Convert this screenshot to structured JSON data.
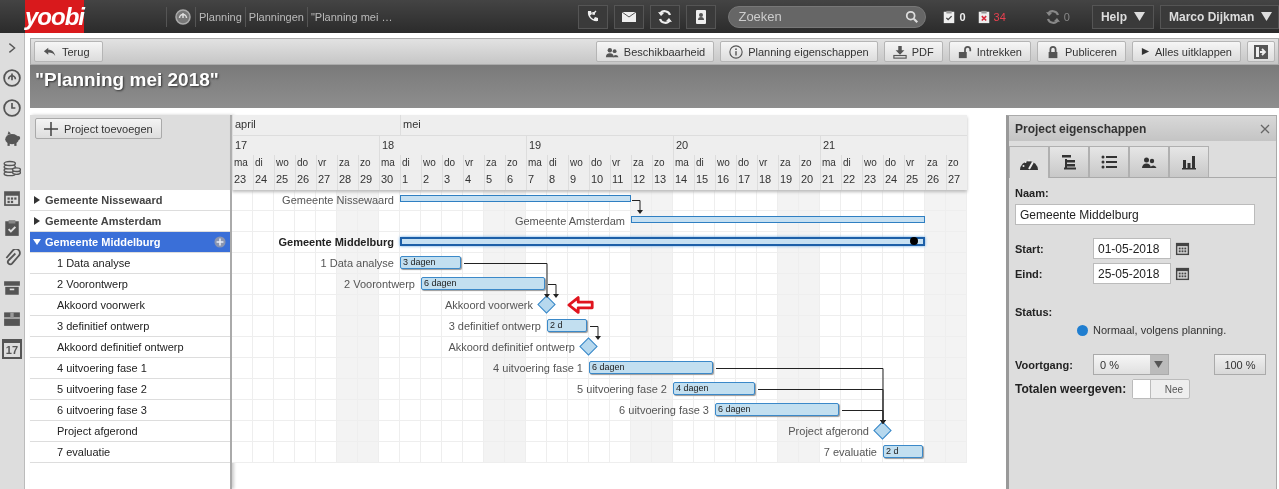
{
  "topbar": {
    "logo": "yoobi",
    "breadcrumbs": [
      "Planning",
      "Planningen",
      "\"Planning mei …"
    ],
    "search": {
      "placeholder": "Zoeken"
    },
    "approved_count": "0",
    "rejected_count": "34",
    "sync_count": "0",
    "help": "Help",
    "user": "Marco Dijkman"
  },
  "sidebar": {
    "calendar_day": "17"
  },
  "toolbar": {
    "back": "Terug",
    "buttons": [
      {
        "label": "Beschikbaarheid",
        "kind": "people"
      },
      {
        "label": "Planning eigenschappen",
        "kind": "info"
      },
      {
        "label": "PDF",
        "kind": "download"
      },
      {
        "label": "Intrekken",
        "kind": "unlock"
      },
      {
        "label": "Publiceren",
        "kind": "lock"
      },
      {
        "label": "Alles uitklappen",
        "kind": "play"
      }
    ]
  },
  "title": "\"Planning mei 2018\"",
  "projects": {
    "add_button": "Project toevoegen",
    "items": [
      {
        "name": "Gemeente Nissewaard",
        "expanded": false,
        "selected": false
      },
      {
        "name": "Gemeente Amsterdam",
        "expanded": false,
        "selected": false
      },
      {
        "name": "Gemeente Middelburg",
        "expanded": true,
        "selected": true,
        "children": [
          {
            "name": "1 Data analyse"
          },
          {
            "name": "2 Voorontwerp"
          },
          {
            "name": "Akkoord voorwerk"
          },
          {
            "name": "3 definitief ontwerp"
          },
          {
            "name": "Akkoord definitief ontwerp"
          },
          {
            "name": "4 uitvoering fase 1"
          },
          {
            "name": "5 uitvoering fase 2"
          },
          {
            "name": "6 uitvoering fase 3"
          },
          {
            "name": "Project afgerond"
          },
          {
            "name": "7 evaluatie"
          }
        ]
      }
    ]
  },
  "timeline": {
    "months": [
      "april",
      "mei"
    ],
    "weeks": [
      {
        "number": "17",
        "days": [
          {
            "dow": "ma",
            "date": "23",
            "weekend": false
          },
          {
            "dow": "di",
            "date": "24",
            "weekend": false
          },
          {
            "dow": "wo",
            "date": "25",
            "weekend": false
          },
          {
            "dow": "do",
            "date": "26",
            "weekend": false
          },
          {
            "dow": "vr",
            "date": "27",
            "weekend": false
          },
          {
            "dow": "za",
            "date": "28",
            "weekend": true
          },
          {
            "dow": "zo",
            "date": "29",
            "weekend": true
          }
        ]
      },
      {
        "number": "18",
        "days": [
          {
            "dow": "ma",
            "date": "30",
            "weekend": false
          },
          {
            "dow": "di",
            "date": "1",
            "weekend": false
          },
          {
            "dow": "wo",
            "date": "2",
            "weekend": false
          },
          {
            "dow": "do",
            "date": "3",
            "weekend": false
          },
          {
            "dow": "vr",
            "date": "4",
            "weekend": false
          },
          {
            "dow": "za",
            "date": "5",
            "weekend": true
          },
          {
            "dow": "zo",
            "date": "6",
            "weekend": true
          }
        ]
      },
      {
        "number": "19",
        "days": [
          {
            "dow": "ma",
            "date": "7",
            "weekend": false
          },
          {
            "dow": "di",
            "date": "8",
            "weekend": false
          },
          {
            "dow": "wo",
            "date": "9",
            "weekend": false
          },
          {
            "dow": "do",
            "date": "10",
            "weekend": false
          },
          {
            "dow": "vr",
            "date": "11",
            "weekend": false
          },
          {
            "dow": "za",
            "date": "12",
            "weekend": true
          },
          {
            "dow": "zo",
            "date": "13",
            "weekend": true
          }
        ]
      },
      {
        "number": "20",
        "days": [
          {
            "dow": "ma",
            "date": "14",
            "weekend": false
          },
          {
            "dow": "di",
            "date": "15",
            "weekend": false
          },
          {
            "dow": "wo",
            "date": "16",
            "weekend": false
          },
          {
            "dow": "do",
            "date": "17",
            "weekend": false
          },
          {
            "dow": "vr",
            "date": "18",
            "weekend": false
          },
          {
            "dow": "za",
            "date": "19",
            "weekend": true
          },
          {
            "dow": "zo",
            "date": "20",
            "weekend": true
          }
        ]
      },
      {
        "number": "21",
        "days": [
          {
            "dow": "ma",
            "date": "21",
            "weekend": false
          },
          {
            "dow": "di",
            "date": "22",
            "weekend": false
          },
          {
            "dow": "wo",
            "date": "23",
            "weekend": false
          },
          {
            "dow": "do",
            "date": "24",
            "weekend": false
          },
          {
            "dow": "vr",
            "date": "25",
            "weekend": false
          },
          {
            "dow": "za",
            "date": "26",
            "weekend": true
          },
          {
            "dow": "zo",
            "date": "27",
            "weekend": true
          }
        ]
      }
    ]
  },
  "gantt": {
    "tasks": [
      {
        "label": "Gemeente Nissewaard",
        "kind": "summary",
        "selected": false
      },
      {
        "label": "Gemeente Amsterdam",
        "kind": "summary",
        "selected": false
      },
      {
        "label": "Gemeente Middelburg",
        "kind": "summary",
        "selected": true
      },
      {
        "label": "1 Data analyse",
        "kind": "task",
        "duration": "3 dagen"
      },
      {
        "label": "2 Voorontwerp",
        "kind": "task",
        "duration": "6 dagen"
      },
      {
        "label": "Akkoord voorwerk",
        "kind": "milestone",
        "highlighted": true
      },
      {
        "label": "3 definitief ontwerp",
        "kind": "task",
        "duration": "2 d"
      },
      {
        "label": "Akkoord definitief ontwerp",
        "kind": "milestone"
      },
      {
        "label": "4 uitvoering fase 1",
        "kind": "task",
        "duration": "6 dagen"
      },
      {
        "label": "5 uitvoering fase 2",
        "kind": "task",
        "duration": "4 dagen"
      },
      {
        "label": "6 uitvoering fase 3",
        "kind": "task",
        "duration": "6 dagen"
      },
      {
        "label": "Project afgerond",
        "kind": "milestone"
      },
      {
        "label": "7 evaluatie",
        "kind": "task",
        "duration": "2 d"
      }
    ]
  },
  "properties": {
    "title": "Project eigenschappen",
    "tabs": [
      {
        "kind": "dashboard",
        "selected": true
      },
      {
        "kind": "gantt",
        "selected": false
      },
      {
        "kind": "list",
        "selected": false
      },
      {
        "kind": "people",
        "selected": false
      },
      {
        "kind": "chart",
        "selected": false
      }
    ],
    "name_label": "Naam:",
    "name": "Gemeente Middelburg",
    "start_label": "Start:",
    "start": "01-05-2018",
    "end_label": "Eind:",
    "end": "25-05-2018",
    "status_label": "Status:",
    "status": {
      "text": "Normaal, volgens planning.",
      "color": "#1f7ed0"
    },
    "progress_label": "Voortgang:",
    "progress": "0 %",
    "complete_button": "100 %",
    "totals_label": "Totalen weergeven:",
    "totals": {
      "on": false,
      "text": "Nee"
    }
  }
}
